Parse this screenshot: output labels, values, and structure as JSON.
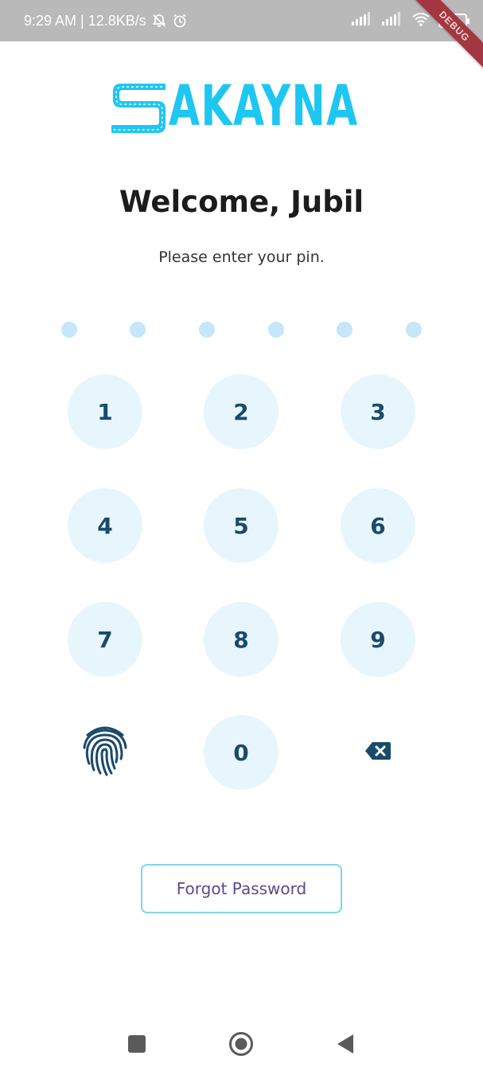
{
  "status_bar": {
    "time_speed": "9:29 AM | 12.8KB/s",
    "battery": "94",
    "icons": [
      "bell-off-icon",
      "alarm-icon",
      "signal-icon",
      "signal-icon",
      "wifi-icon",
      "battery-icon"
    ]
  },
  "debug_banner": "DEBUG",
  "logo": {
    "text": "AKAYNA",
    "letter": "S",
    "color": "#1ec6f2"
  },
  "welcome": "Welcome, Jubil",
  "subtitle": "Please enter your pin.",
  "pin": {
    "length": 6,
    "filled": 0,
    "dot_color": "#c5e6fb"
  },
  "keypad": {
    "keys": [
      "1",
      "2",
      "3",
      "4",
      "5",
      "6",
      "7",
      "8",
      "9",
      "0"
    ],
    "fingerprint_icon": "fingerprint-icon",
    "backspace_icon": "backspace-icon"
  },
  "forgot_password": "Forgot Password",
  "nav": {
    "icons": [
      "recents-icon",
      "home-icon",
      "back-icon"
    ]
  },
  "colors": {
    "accent": "#1ec6f2",
    "key_bg": "#e7f6fd",
    "key_text": "#1b4a6b",
    "forgot_text": "#5a4a8a"
  }
}
